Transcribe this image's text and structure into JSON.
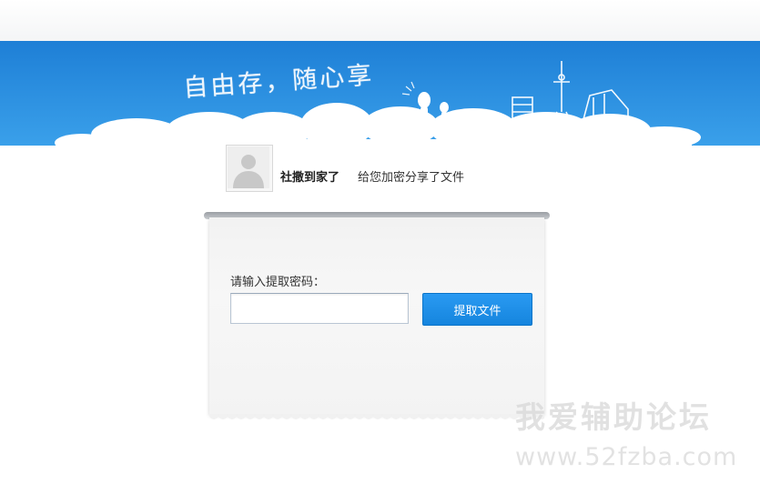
{
  "banner": {
    "slogan": "自由存，随心享",
    "sky_color": "#2a8bde",
    "icons": [
      "doodle-characters-icon",
      "city-skyline-icon"
    ]
  },
  "sharer": {
    "avatar_icon": "default-user-avatar-icon",
    "username": "社撒到家了",
    "message": "给您加密分享了文件"
  },
  "form": {
    "label": "请输入提取密码：",
    "input_value": "",
    "button_label": "提取文件",
    "button_color": "#1a8ee6"
  },
  "watermark": {
    "title": "我爱辅助论坛",
    "url": "www.52fzba.com"
  }
}
